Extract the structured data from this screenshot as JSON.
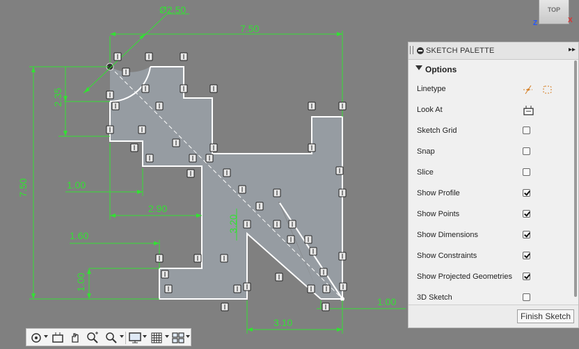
{
  "sketch": {
    "dimensions": {
      "diameter": "Ø2.50",
      "top_width": "7.50",
      "left_height": "7.50",
      "arc_height": "2.35",
      "offset_a": "1.00",
      "offset_b": "2.90",
      "offset_c": "1.60",
      "notch_height": "1.00",
      "diag_height": "3.20",
      "bottom_width": "3.10",
      "right_offset": "1.00"
    }
  },
  "viewcube": {
    "face_label": "TOP",
    "axis_z": "Z",
    "axis_x": "X"
  },
  "palette": {
    "title": "SKETCH PALETTE",
    "section_label": "Options",
    "options": [
      {
        "label": "Linetype",
        "control": "linetype"
      },
      {
        "label": "Look At",
        "control": "lookat"
      },
      {
        "label": "Sketch Grid",
        "control": "checkbox",
        "checked": false
      },
      {
        "label": "Snap",
        "control": "checkbox",
        "checked": false
      },
      {
        "label": "Slice",
        "control": "checkbox",
        "checked": false
      },
      {
        "label": "Show Profile",
        "control": "checkbox",
        "checked": true
      },
      {
        "label": "Show Points",
        "control": "checkbox",
        "checked": true
      },
      {
        "label": "Show Dimensions",
        "control": "checkbox",
        "checked": true
      },
      {
        "label": "Show Constraints",
        "control": "checkbox",
        "checked": true
      },
      {
        "label": "Show Projected Geometries",
        "control": "checkbox",
        "checked": true
      },
      {
        "label": "3D Sketch",
        "control": "checkbox",
        "checked": false
      }
    ],
    "finish_label": "Finish Sketch"
  },
  "navbar": {
    "tools": [
      "orbit-icon",
      "look-at-icon",
      "pan-icon",
      "zoom-icon",
      "fit-icon",
      "display-settings-icon",
      "grid-settings-icon",
      "viewports-icon"
    ]
  },
  "colors": {
    "canvas": "#808080",
    "profile_fill": "#9aa1a8",
    "sketch_line": "#ffffff",
    "dimension": "#33e033",
    "panel": "#f0f0f0"
  }
}
